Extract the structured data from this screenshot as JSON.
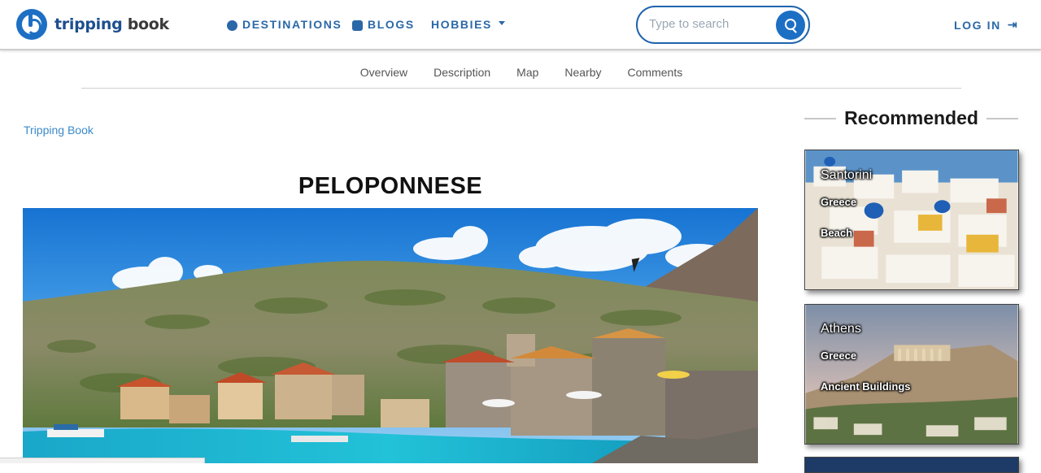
{
  "brand": {
    "name_part1": "tripping",
    "name_part2": "book"
  },
  "nav": {
    "destinations": "DESTINATIONS",
    "blogs": "BLOGS",
    "hobbies": "HOBBIES",
    "login": "LOG IN"
  },
  "search": {
    "placeholder": "Type to search"
  },
  "subnav": [
    "Overview",
    "Description",
    "Map",
    "Nearby",
    "Comments"
  ],
  "breadcrumb": "Tripping Book",
  "page": {
    "title": "PELOPONNESE"
  },
  "sidebar": {
    "heading": "Recommended",
    "cards": [
      {
        "name": "Santorini",
        "country": "Greece",
        "category": "Beach"
      },
      {
        "name": "Athens",
        "country": "Greece",
        "category": "Ancient Buildings"
      }
    ]
  },
  "colors": {
    "brand": "#1d6fc4",
    "nav_text": "#2a68a8",
    "link": "#3b8ac9"
  },
  "icons": {
    "destinations": "globe-icon",
    "blogs": "blog-icon",
    "hobbies": "chevron-down-icon",
    "login": "sign-in-icon",
    "search": "search-icon"
  }
}
